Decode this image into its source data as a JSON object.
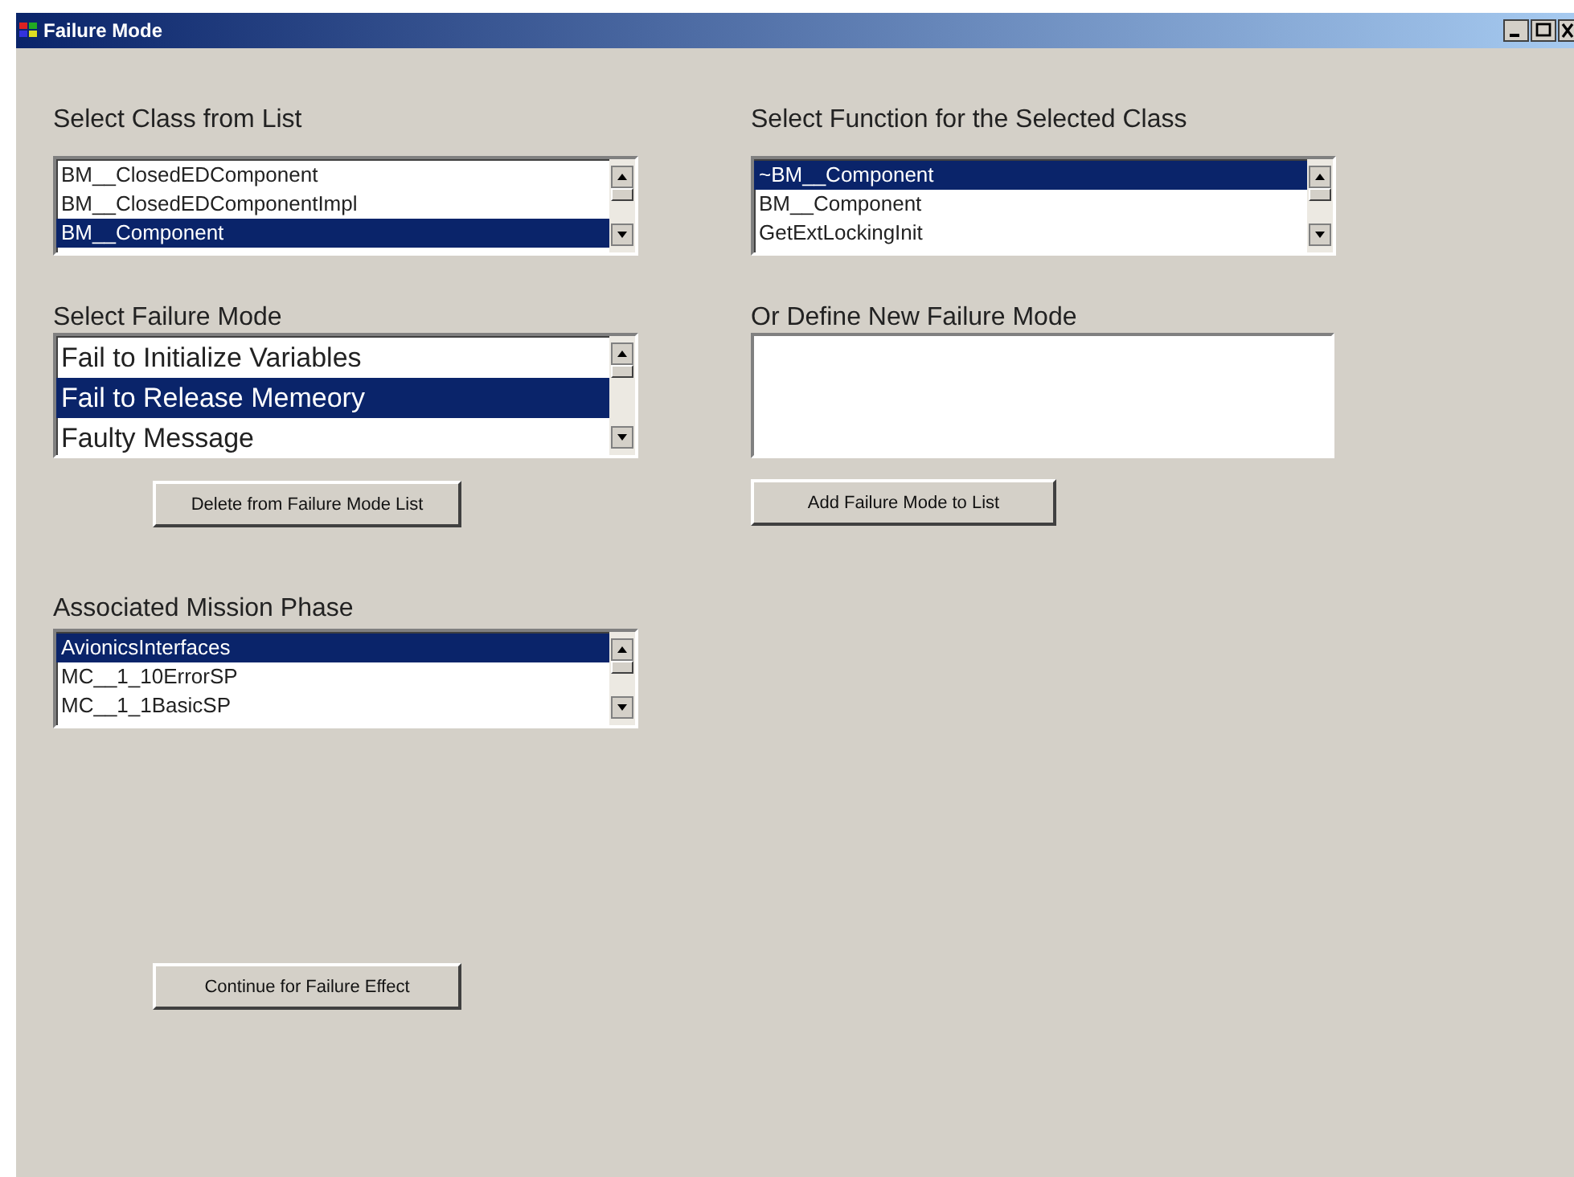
{
  "window": {
    "title": "Failure Mode"
  },
  "class_list": {
    "label": "Select Class from List",
    "items": [
      {
        "text": "BM__ClosedEDComponent",
        "selected": false
      },
      {
        "text": "BM__ClosedEDComponentImpl",
        "selected": false
      },
      {
        "text": "BM__Component",
        "selected": true
      }
    ]
  },
  "function_list": {
    "label": "Select Function for the Selected Class",
    "items": [
      {
        "text": "~BM__Component",
        "selected": true
      },
      {
        "text": "BM__Component",
        "selected": false
      },
      {
        "text": "GetExtLockingInit",
        "selected": false
      }
    ]
  },
  "failure_mode_list": {
    "label": "Select Failure Mode",
    "items": [
      {
        "text": "Fail to Initialize Variables",
        "selected": false
      },
      {
        "text": "Fail to Release Memeory",
        "selected": true
      },
      {
        "text": "Faulty Message",
        "selected": false
      }
    ]
  },
  "new_failure_mode": {
    "label": "Or Define New Failure Mode"
  },
  "delete_button": "Delete from Failure Mode List",
  "add_button": "Add Failure Mode to List",
  "mission_phase_list": {
    "label": "Associated Mission Phase",
    "items": [
      {
        "text": "AvionicsInterfaces",
        "selected": true
      },
      {
        "text": "MC__1_10ErrorSP",
        "selected": false
      },
      {
        "text": "MC__1_1BasicSP",
        "selected": false
      }
    ]
  },
  "continue_button": "Continue for Failure Effect"
}
